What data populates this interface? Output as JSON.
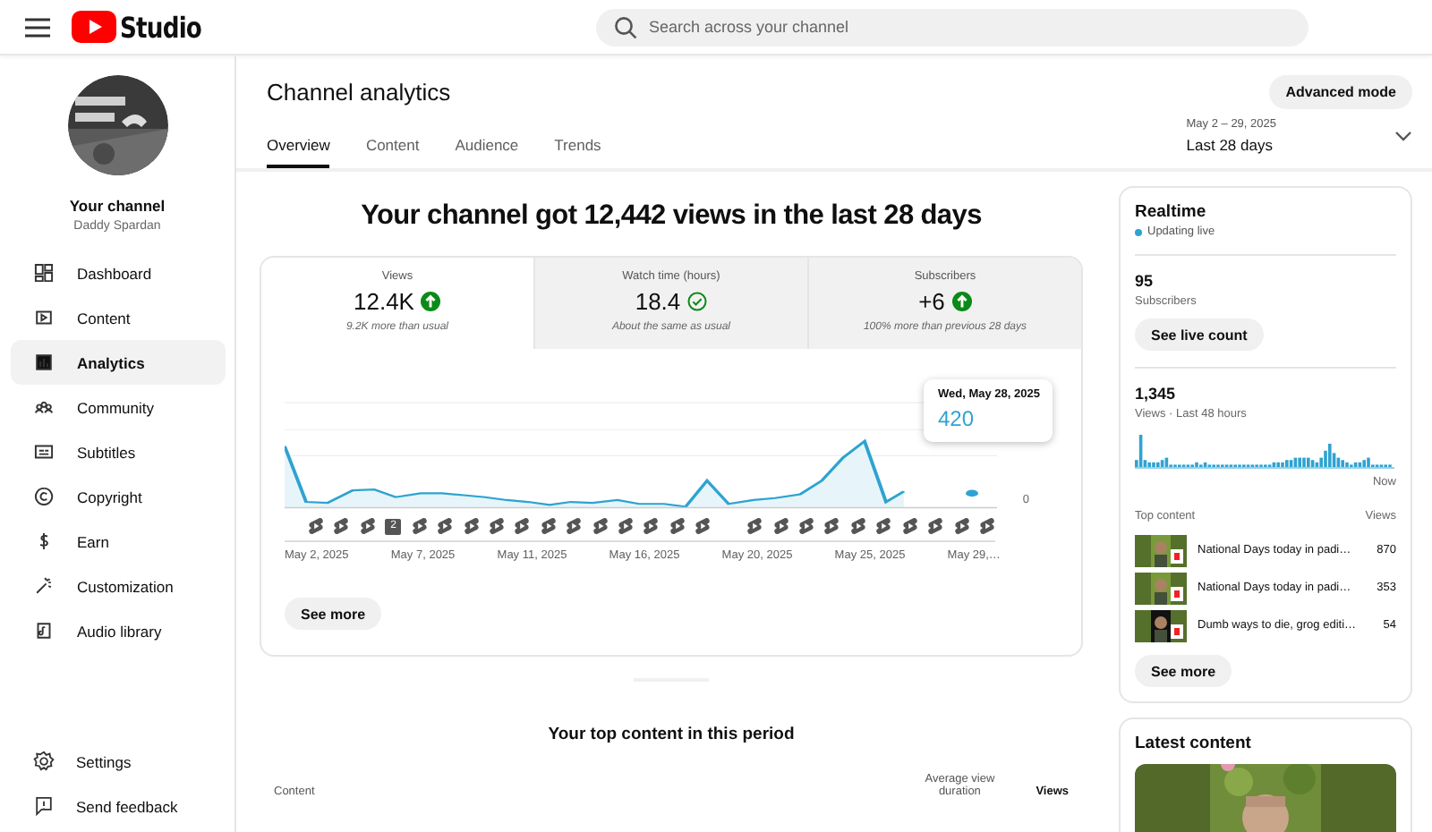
{
  "header": {
    "logo_text": "Studio",
    "search": {
      "placeholder": "Search across your channel"
    }
  },
  "sidebar": {
    "channel_title": "Your channel",
    "channel_name": "Daddy Spardan",
    "items": [
      {
        "label": "Dashboard",
        "selected": false
      },
      {
        "label": "Content",
        "selected": false
      },
      {
        "label": "Analytics",
        "selected": true
      },
      {
        "label": "Community",
        "selected": false
      },
      {
        "label": "Subtitles",
        "selected": false
      },
      {
        "label": "Copyright",
        "selected": false
      },
      {
        "label": "Earn",
        "selected": false
      },
      {
        "label": "Customization",
        "selected": false
      },
      {
        "label": "Audio library",
        "selected": false
      }
    ],
    "bottom_items": [
      {
        "label": "Settings"
      },
      {
        "label": "Send feedback"
      }
    ]
  },
  "page": {
    "title": "Channel analytics",
    "advanced_button": "Advanced mode",
    "tabs": [
      {
        "label": "Overview",
        "selected": true
      },
      {
        "label": "Content",
        "selected": false
      },
      {
        "label": "Audience",
        "selected": false
      },
      {
        "label": "Trends",
        "selected": false
      }
    ],
    "date_range": {
      "dates": "May 2 – 29, 2025",
      "label": "Last 28 days"
    },
    "headline": "Your channel got 12,442 views in the last 28 days",
    "metrics": [
      {
        "label": "Views",
        "value": "12.4K",
        "kind": "up",
        "note": "9.2K more than usual",
        "selected": true
      },
      {
        "label": "Watch time (hours)",
        "value": "18.4",
        "kind": "same",
        "note": "About the same as usual",
        "selected": false
      },
      {
        "label": "Subscribers",
        "value": "+6",
        "kind": "up",
        "note": "100% more than previous 28 days",
        "selected": false
      }
    ],
    "chart": {
      "y_tick": "0",
      "x_labels": [
        "May 2, 2025",
        "May 7, 2025",
        "May 11, 2025",
        "May 16, 2025",
        "May 20, 2025",
        "May 25, 2025",
        "May 29,…"
      ],
      "markers": [
        {
          "kind": "short"
        },
        {
          "kind": "short"
        },
        {
          "kind": "short"
        },
        {
          "kind": "count",
          "label": "2"
        },
        {
          "kind": "short"
        },
        {
          "kind": "short"
        },
        {
          "kind": "short"
        },
        {
          "kind": "short"
        },
        {
          "kind": "short"
        },
        {
          "kind": "short"
        },
        {
          "kind": "short"
        },
        {
          "kind": "short"
        },
        {
          "kind": "short"
        },
        {
          "kind": "short"
        },
        {
          "kind": "short"
        },
        {
          "kind": "short"
        },
        {
          "kind": "gap"
        },
        {
          "kind": "short"
        },
        {
          "kind": "short"
        },
        {
          "kind": "short"
        },
        {
          "kind": "short"
        },
        {
          "kind": "short"
        },
        {
          "kind": "short"
        },
        {
          "kind": "short"
        },
        {
          "kind": "short"
        },
        {
          "kind": "short"
        },
        {
          "kind": "short"
        }
      ],
      "tooltip": {
        "date": "Wed, May 28, 2025",
        "value": "420"
      }
    },
    "see_more": "See more",
    "top_content": {
      "title": "Your top content in this period",
      "columns": [
        "Content",
        "Average view duration",
        "Views"
      ]
    }
  },
  "realtime": {
    "title": "Realtime",
    "status": "Updating live",
    "subscribers": "95",
    "subscribers_label": "Subscribers",
    "live_button": "See live count",
    "views": "1,345",
    "views_label": "Views · Last 48 hours",
    "now_label": "Now",
    "top_label": "Top content",
    "views_col": "Views",
    "items": [
      {
        "title": "National Days today in padi…",
        "views": "870"
      },
      {
        "title": "National Days today in padi…",
        "views": "353"
      },
      {
        "title": "Dumb ways to die, grog editi…",
        "views": "54"
      }
    ],
    "see_more": "See more"
  },
  "latest": {
    "title": "Latest content"
  }
}
